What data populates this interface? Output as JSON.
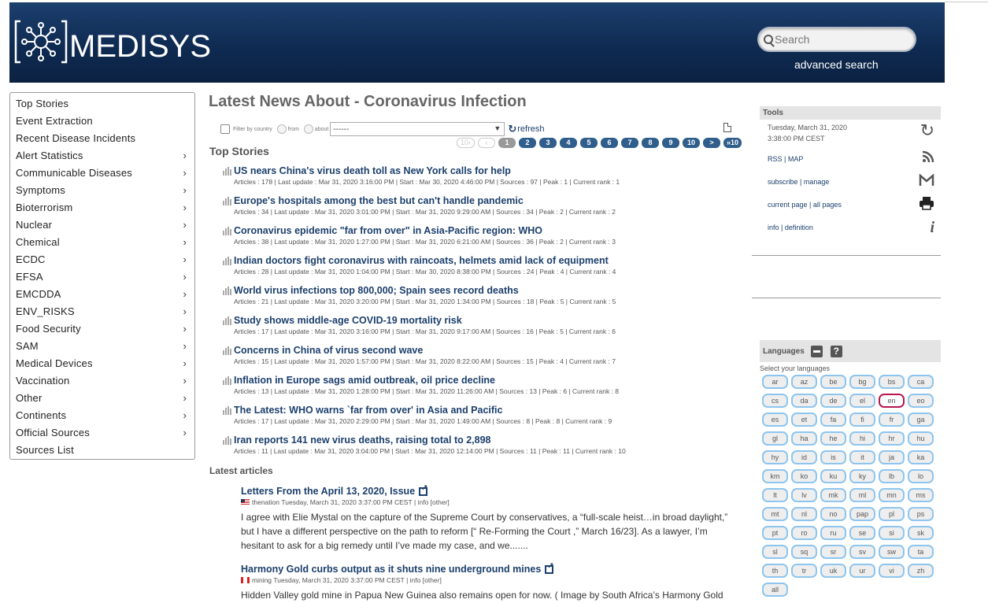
{
  "header": {
    "brand": "MEDISYS",
    "search_placeholder": "Search",
    "advanced_search": "advanced search"
  },
  "sidebar": {
    "items": [
      {
        "label": "Top Stories",
        "has_submenu": false
      },
      {
        "label": "Event Extraction",
        "has_submenu": false
      },
      {
        "label": "Recent Disease Incidents",
        "has_submenu": false
      },
      {
        "label": "Alert Statistics",
        "has_submenu": true
      },
      {
        "label": "Communicable Diseases",
        "has_submenu": true
      },
      {
        "label": "Symptoms",
        "has_submenu": true
      },
      {
        "label": "Bioterrorism",
        "has_submenu": true
      },
      {
        "label": "Nuclear",
        "has_submenu": true
      },
      {
        "label": "Chemical",
        "has_submenu": true
      },
      {
        "label": "ECDC",
        "has_submenu": true
      },
      {
        "label": "EFSA",
        "has_submenu": true
      },
      {
        "label": "EMCDDA",
        "has_submenu": true
      },
      {
        "label": "ENV_RISKS",
        "has_submenu": true
      },
      {
        "label": "Food Security",
        "has_submenu": true
      },
      {
        "label": "SAM",
        "has_submenu": true
      },
      {
        "label": "Medical Devices",
        "has_submenu": true
      },
      {
        "label": "Vaccination",
        "has_submenu": true
      },
      {
        "label": "Other",
        "has_submenu": true
      },
      {
        "label": "Continents",
        "has_submenu": true
      },
      {
        "label": "Official Sources",
        "has_submenu": true
      },
      {
        "label": "Sources List",
        "has_submenu": false
      }
    ]
  },
  "main": {
    "title": "Latest News About - Coronavirus Infection",
    "filter": {
      "filter_label": "Filter by country",
      "from_label": "from",
      "about_label": "about",
      "select_value": "------",
      "refresh_label": "refresh"
    },
    "top_stories_heading": "Top Stories",
    "pager": [
      "10‹",
      "‹",
      "1",
      "2",
      "3",
      "4",
      "5",
      "6",
      "7",
      "8",
      "9",
      "10",
      ">",
      "»10"
    ],
    "pager_current": "1",
    "stories": [
      {
        "title": "US nears China's virus death toll as New York calls for help",
        "meta": "Articles : 178 | Last update : Mar 31, 2020 3:16:00 PM | Start : Mar 30, 2020 4:46:00 PM | Sources : 97 | Peak : 1 | Current rank : 1"
      },
      {
        "title": "Europe's hospitals among the best but can't handle pandemic",
        "meta": "Articles : 34 | Last update : Mar 31, 2020 3:01:00 PM | Start : Mar 31, 2020 9:29:00 AM | Sources : 34 | Peak : 2 | Current rank : 2"
      },
      {
        "title": "Coronavirus epidemic \"far from over\" in Asia-Pacific region: WHO",
        "meta": "Articles : 38 | Last update : Mar 31, 2020 1:27:00 PM | Start : Mar 31, 2020 6:21:00 AM | Sources : 36 | Peak : 2 | Current rank : 3"
      },
      {
        "title": "Indian doctors fight coronavirus with raincoats, helmets amid lack of equipment",
        "meta": "Articles : 28 | Last update : Mar 31, 2020 1:04:00 PM | Start : Mar 30, 2020 8:38:00 PM | Sources : 24 | Peak : 4 | Current rank : 4"
      },
      {
        "title": "World virus infections top 800,000; Spain sees record deaths",
        "meta": "Articles : 21 | Last update : Mar 31, 2020 3:20:00 PM | Start : Mar 31, 2020 1:34:00 PM | Sources : 18 | Peak : 5 | Current rank : 5"
      },
      {
        "title": "Study shows middle-age COVID-19 mortality risk",
        "meta": "Articles : 17 | Last update : Mar 31, 2020 3:16:00 PM | Start : Mar 31, 2020 9:17:00 AM | Sources : 16 | Peak : 5 | Current rank : 6"
      },
      {
        "title": "Concerns in China of virus second wave",
        "meta": "Articles : 15 | Last update : Mar 31, 2020 1:57:00 PM | Start : Mar 31, 2020 8:22:00 AM | Sources : 15 | Peak : 4 | Current rank : 7"
      },
      {
        "title": "Inflation in Europe sags amid outbreak, oil price decline",
        "meta": "Articles : 13 | Last update : Mar 31, 2020 1:28:00 PM | Start : Mar 31, 2020 11:26:00 AM | Sources : 13 | Peak : 6 | Current rank : 8"
      },
      {
        "title": "The Latest: WHO warns `far from over' in Asia and Pacific",
        "meta": "Articles : 17 | Last update : Mar 31, 2020 2:29:00 PM | Start : Mar 31, 2020 1:49:00 AM | Sources : 8 | Peak : 8 | Current rank : 9"
      },
      {
        "title": "Iran reports 141 new virus deaths, raising total to 2,898",
        "meta": "Articles : 11 | Last update : Mar 31, 2020 3:04:00 PM | Start : Mar 31, 2020 12:14:00 PM | Sources : 11 | Peak : 11 | Current rank : 10"
      }
    ],
    "latest_heading": "Latest articles",
    "articles": [
      {
        "title": "Letters From the April 13, 2020, Issue",
        "source": "thenation",
        "flag": "us",
        "date": "Tuesday, March 31, 2020 3:37:00 PM CEST",
        "links": "info [other]",
        "text": "I agree with Elie Mystal on the capture of the Supreme Court by conservatives, a “full-scale heist…in broad daylight,” but I have a different perspective on the path to reform [“ Re-Forming the Court ,” March 16/23]. As a lawyer, I’m hesitant to ask for a big remedy until I’ve made my case, and we......."
      },
      {
        "title": "Harmony Gold curbs output as it shuts nine underground mines",
        "source": "mining",
        "flag": "ca",
        "date": "Tuesday, March 31, 2020 3:37:00 PM CEST",
        "links": "info [other]",
        "text": "Hidden Valley gold mine in Papua New Guinea also remains open for now. ( Image by South Africa’s Harmony Gold"
      }
    ]
  },
  "tools": {
    "heading": "Tools",
    "date_line1": "Tuesday, March 31, 2020",
    "date_line2": "3:38:00 PM CEST",
    "rss": "RSS",
    "map": "MAP",
    "subscribe": "subscribe",
    "manage": "manage",
    "current_page": "current page",
    "all_pages": "all pages",
    "info": "info",
    "definition": "definition",
    "icons": [
      "refresh-icon",
      "rss-icon",
      "mail-icon",
      "print-icon",
      "info-icon"
    ]
  },
  "languages": {
    "heading": "Languages",
    "help": "?",
    "select_text": "Select your languages",
    "list": [
      "ar",
      "az",
      "be",
      "bg",
      "bs",
      "ca",
      "cs",
      "da",
      "de",
      "el",
      "en",
      "eo",
      "es",
      "et",
      "fa",
      "fi",
      "fr",
      "ga",
      "gl",
      "ha",
      "he",
      "hi",
      "hr",
      "hu",
      "hy",
      "id",
      "is",
      "it",
      "ja",
      "ka",
      "km",
      "ko",
      "ku",
      "ky",
      "lb",
      "lo",
      "lt",
      "lv",
      "mk",
      "ml",
      "mn",
      "ms",
      "mt",
      "nl",
      "no",
      "pap",
      "pl",
      "ps",
      "pt",
      "ro",
      "ru",
      "se",
      "si",
      "sk",
      "sl",
      "sq",
      "sr",
      "sv",
      "sw",
      "ta",
      "th",
      "tr",
      "uk",
      "ur",
      "vi",
      "zh",
      "all"
    ],
    "selected": "en",
    "selected_border_color": "#b8164f",
    "pill_border_color": "#8ec5ee"
  },
  "colors": {
    "header_bg": "#0f2b52",
    "link": "#1b3f6c",
    "pager": "#2f5e8c"
  }
}
